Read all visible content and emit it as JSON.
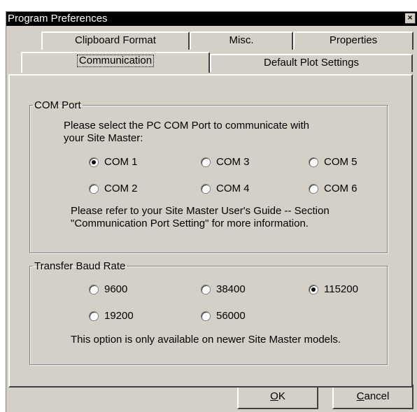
{
  "window": {
    "title": "Program Preferences",
    "close_glyph": "×"
  },
  "tabs": {
    "row_back": [
      {
        "label": "Clipboard Format"
      },
      {
        "label": "Misc."
      },
      {
        "label": "Properties"
      }
    ],
    "row_front": [
      {
        "label": "Communication",
        "active": true
      },
      {
        "label": "Default Plot Settings",
        "active": false
      }
    ]
  },
  "com_port": {
    "legend": "COM Port",
    "instruction_line1": "Please select the PC COM Port to communicate with",
    "instruction_line2": "your Site Master:",
    "options": [
      {
        "label": "COM 1",
        "checked": true
      },
      {
        "label": "COM 3",
        "checked": false
      },
      {
        "label": "COM 5",
        "checked": false
      },
      {
        "label": "COM 2",
        "checked": false
      },
      {
        "label": "COM 4",
        "checked": false
      },
      {
        "label": "COM 6",
        "checked": false
      }
    ],
    "note_line1": "Please refer to your Site Master User's Guide  -- Section",
    "note_line2": "\"Communication Port Setting\" for more information."
  },
  "baud": {
    "legend": "Transfer Baud Rate",
    "options": [
      {
        "label": "9600",
        "checked": false
      },
      {
        "label": "38400",
        "checked": false
      },
      {
        "label": "115200",
        "checked": true
      },
      {
        "label": "19200",
        "checked": false
      },
      {
        "label": "56000",
        "checked": false
      }
    ],
    "note": "This option is only available on newer Site Master models."
  },
  "buttons": {
    "ok_mnemonic": "O",
    "ok_rest": "K",
    "cancel_mnemonic": "C",
    "cancel_rest": "ancel"
  }
}
